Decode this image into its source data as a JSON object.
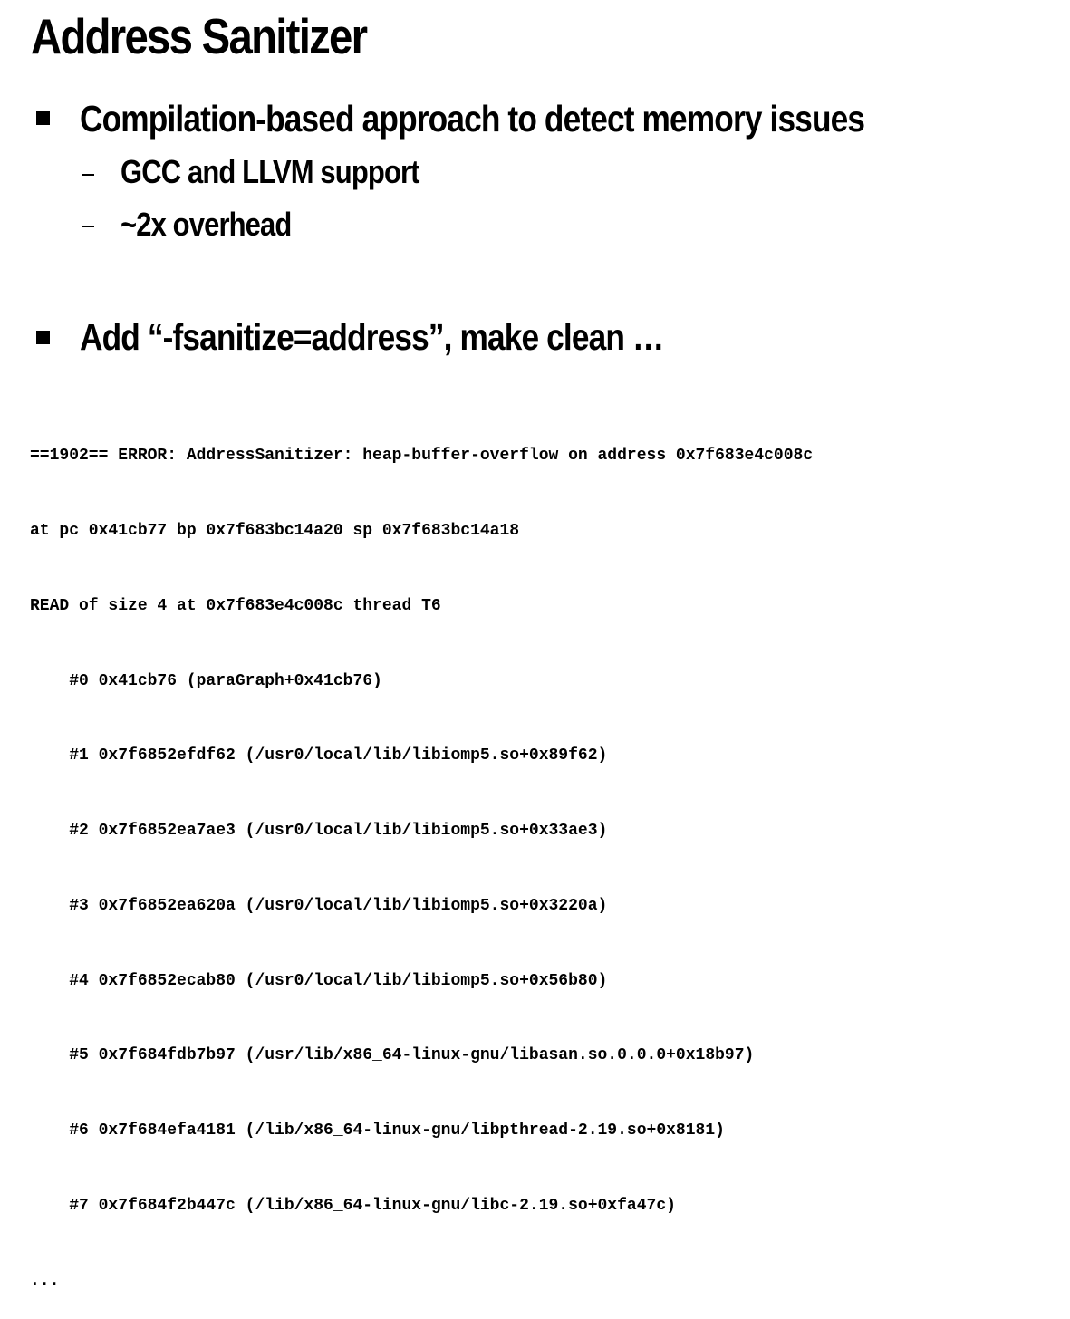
{
  "slide": {
    "title": "Address Sanitizer",
    "bullets": [
      {
        "text": "Compilation-based approach to detect memory issues",
        "sub_items": [
          "GCC and LLVM support",
          "~2x overhead"
        ]
      },
      {
        "text": "Add “-fsanitize=address”, make clean …",
        "sub_items": []
      }
    ],
    "code_lines": [
      "==1902== ERROR: AddressSanitizer: heap-buffer-overflow on address 0x7f683e4c008c",
      "at pc 0x41cb77 bp 0x7f683bc14a20 sp 0x7f683bc14a18",
      "READ of size 4 at 0x7f683e4c008c thread T6",
      "    #0 0x41cb76 (paraGraph+0x41cb76)",
      "    #1 0x7f6852efdf62 (/usr0/local/lib/libiomp5.so+0x89f62)",
      "    #2 0x7f6852ea7ae3 (/usr0/local/lib/libiomp5.so+0x33ae3)",
      "    #3 0x7f6852ea620a (/usr0/local/lib/libiomp5.so+0x3220a)",
      "    #4 0x7f6852ecab80 (/usr0/local/lib/libiomp5.so+0x56b80)",
      "    #5 0x7f684fdb7b97 (/usr/lib/x86_64-linux-gnu/libasan.so.0.0.0+0x18b97)",
      "    #6 0x7f684efa4181 (/lib/x86_64-linux-gnu/libpthread-2.19.so+0x8181)",
      "    #7 0x7f684f2b447c (/lib/x86_64-linux-gnu/libc-2.19.so+0xfa47c)",
      "..."
    ]
  }
}
